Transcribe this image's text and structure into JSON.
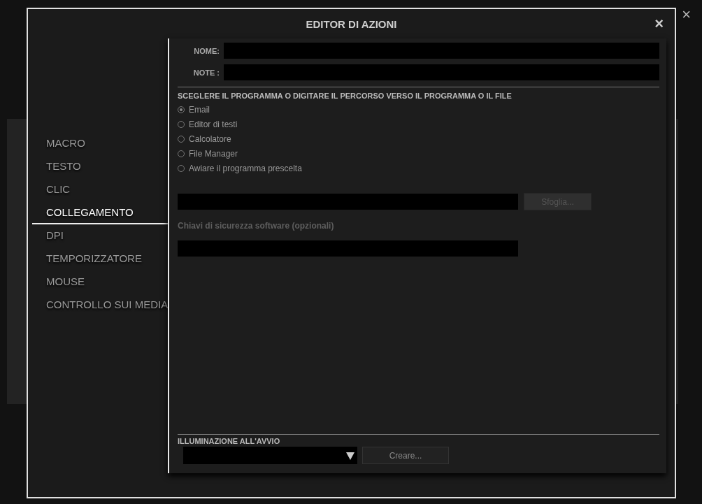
{
  "dialog": {
    "title": "EDITOR DI AZIONI",
    "close": "×",
    "outer_close": "×"
  },
  "nav": [
    {
      "label": "MACRO",
      "selected": false
    },
    {
      "label": "TESTO",
      "selected": false
    },
    {
      "label": "CLIC",
      "selected": false
    },
    {
      "label": "COLLEGAMENTO",
      "selected": true
    },
    {
      "label": "DPI",
      "selected": false
    },
    {
      "label": "TEMPORIZZATORE",
      "selected": false
    },
    {
      "label": "MOUSE",
      "selected": false
    },
    {
      "label": "CONTROLLO SUI MEDIA",
      "selected": false
    }
  ],
  "fields": [
    {
      "label": "NOME:"
    },
    {
      "label": "NOTE :"
    }
  ],
  "program_section": {
    "heading": "SCEGLERE IL PROGRAMMA O DIGITARE IL PERCORSO VERSO IL PROGRAMMA O IL FILE",
    "options": [
      {
        "label": "Email",
        "selected": true
      },
      {
        "label": "Editor di testi",
        "selected": false
      },
      {
        "label": "Calcolatore",
        "selected": false
      },
      {
        "label": "File Manager",
        "selected": false
      },
      {
        "label": "Awiare il programma prescelta",
        "selected": false
      }
    ],
    "browse_button": "Sfoglia...",
    "keys_label": "Chiavi di sicurezza software (opzionali)"
  },
  "lighting": {
    "heading": "ILLUMINAZIONE ALL'AVVIO",
    "create_button": "Creare..."
  }
}
